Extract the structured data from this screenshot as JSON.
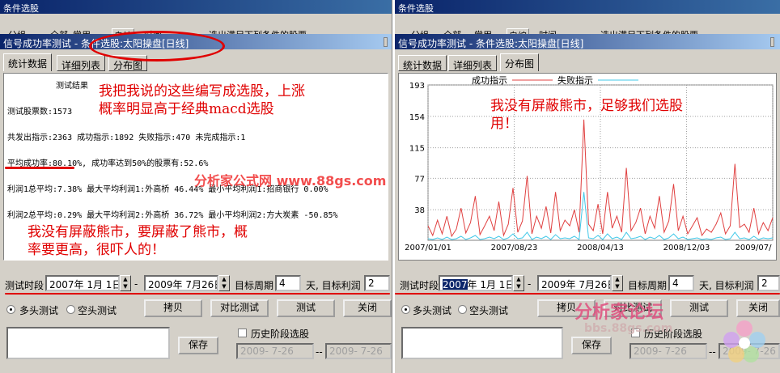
{
  "left": {
    "window_title": "条件选股",
    "outer_tabs": [
      "分组",
      "全部",
      "常用",
      "自编",
      "时间"
    ],
    "condition_title": "选出满足下列条件的股票",
    "inner_title": "信号成功率测试 - 条件选股:太阳操盘[日线]",
    "tabs": [
      "统计数据",
      "详细列表",
      "分布图"
    ],
    "stats": {
      "header": "测试结果",
      "stock_count": "测试股票数:1573",
      "signals": "共发出指示:2363 成功指示:1892 失败指示:470 未完成指示:1",
      "success_rate": "平均成功率:80.10%, 成功率达到50%的股票有:52.6%",
      "profit1": "利润1总平均:7.38% 最大平均利润1:外高桥    46.44% 最小平均利润1:招商银行 0.00%",
      "profit2": "利润2总平均:0.29% 最大平均利润2:外高桥    36.72% 最小平均利润2:方大炭素 -50.85%"
    },
    "annotation1": "我把我说的这些编写成选股，上涨\n概率明显高于经典macd选股",
    "annotation2": "我没有屏蔽熊市，要屏蔽了熊市，概\n率要更高，很吓人的！",
    "watermark": "分析家公式网  www.88gs.com",
    "period_label": "测试时段",
    "date_from": "2007年 1月 1日",
    "date_to": "2009年 7月26日",
    "target_period_label": "目标周期",
    "target_period": "4",
    "target_profit_label": "天, 目标利润",
    "target_profit": "2",
    "radio_long": "多头测试",
    "radio_short": "空头测试",
    "buttons": {
      "copy": "拷贝",
      "compare": "对比测试",
      "test": "测试",
      "close": "关闭",
      "save": "保存"
    },
    "history_label": "历史阶段选股",
    "hist_from": "2009- 7-26",
    "hist_to": "2009- 7-26"
  },
  "right": {
    "window_title": "条件选股",
    "outer_tabs": [
      "分组",
      "全部",
      "常用",
      "自编",
      "时间"
    ],
    "condition_title": "选出满足下列条件的股票",
    "inner_title": "信号成功率测试 - 条件选股:太阳操盘[日线]",
    "tabs": [
      "统计数据",
      "详细列表",
      "分布图"
    ],
    "legend_success": "成功指示",
    "legend_fail": "失败指示",
    "annotation": "我没有屏蔽熊市，足够我们选股\n用！",
    "period_label": "测试时段",
    "date_from_year": "2007",
    "date_from_rest": "年  1月  1日",
    "date_to": "2009年 7月26日",
    "target_period_label": "目标周期",
    "target_period": "4",
    "target_profit_label": "天, 目标利润",
    "target_profit": "2",
    "radio_long": "多头测试",
    "radio_short": "空头测试",
    "buttons": {
      "copy": "拷贝",
      "compare": "对比测试",
      "test": "测试",
      "close": "关闭",
      "save": "保存"
    },
    "history_label": "历史阶段选股",
    "hist_from": "2009- 7-26",
    "hist_to": "2009- 7-26",
    "watermark": "分析家论坛",
    "watermark_url": "bbs.88gs.com"
  },
  "colors": {
    "success": "#e04040",
    "fail": "#40c8e8",
    "annotation": "#e00000"
  },
  "chart_data": {
    "type": "line",
    "yticks": [
      193,
      154,
      115,
      77,
      38
    ],
    "ylim": [
      0,
      193
    ],
    "xticks": [
      "2007/01/01",
      "2007/08/23",
      "2008/04/13",
      "2008/12/03",
      "2009/07/"
    ],
    "series": [
      {
        "name": "成功指示",
        "color": "#e04040",
        "values": [
          18,
          6,
          25,
          8,
          30,
          5,
          14,
          40,
          9,
          22,
          55,
          7,
          18,
          30,
          12,
          48,
          6,
          20,
          65,
          10,
          24,
          80,
          8,
          30,
          15,
          42,
          9,
          60,
          12,
          25,
          18,
          38,
          10,
          150,
          20,
          12,
          45,
          8,
          60,
          15,
          30,
          10,
          90,
          12,
          22,
          40,
          8,
          30,
          15,
          55,
          10,
          24,
          70,
          12,
          30,
          8,
          18,
          28,
          6,
          14,
          10,
          20,
          34,
          8,
          18,
          95,
          16,
          20,
          10,
          40,
          8,
          22,
          12,
          28
        ]
      },
      {
        "name": "失败指示",
        "color": "#40c8e8",
        "values": [
          2,
          1,
          3,
          1,
          4,
          1,
          2,
          5,
          1,
          3,
          6,
          1,
          2,
          4,
          2,
          5,
          1,
          3,
          8,
          2,
          3,
          10,
          1,
          4,
          2,
          5,
          1,
          7,
          2,
          3,
          2,
          5,
          1,
          60,
          3,
          2,
          6,
          1,
          8,
          2,
          4,
          1,
          10,
          2,
          3,
          5,
          1,
          4,
          2,
          6,
          1,
          3,
          8,
          2,
          4,
          1,
          2,
          3,
          1,
          2,
          1,
          3,
          4,
          1,
          2,
          10,
          2,
          3,
          1,
          5,
          1,
          3,
          2,
          3
        ]
      }
    ]
  }
}
